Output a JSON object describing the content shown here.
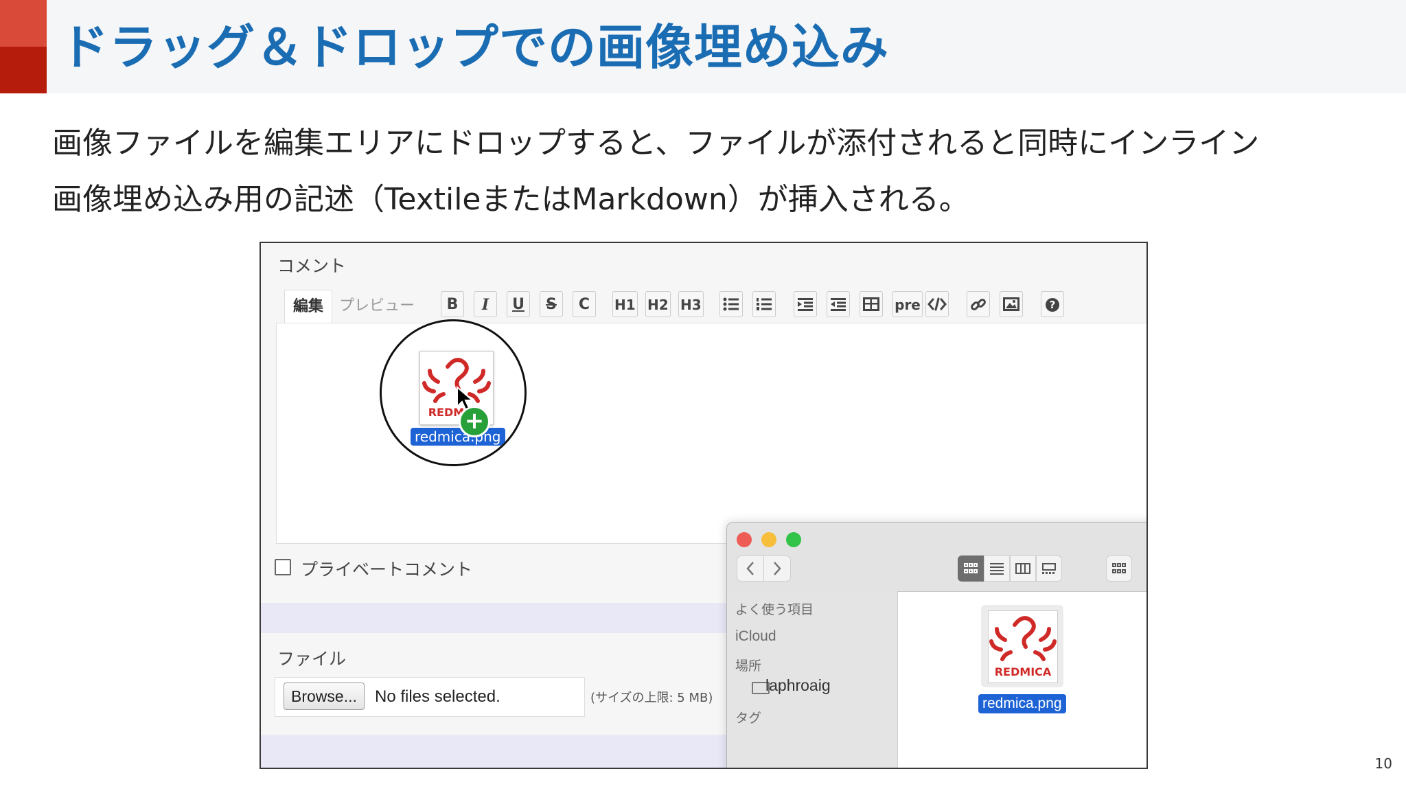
{
  "slide": {
    "title": "ドラッグ＆ドロップでの画像埋め込み",
    "body_line1": "画像ファイルを編集エリアにドロップすると、ファイルが添付されると同時にインライン",
    "body_line2": "画像埋め込み用の記述（TextileまたはMarkdown）が挿入される。",
    "page_number": "10",
    "colors": {
      "title": "#1b6db3",
      "accent_top": "#d94a38",
      "accent_bottom": "#b51c0c"
    }
  },
  "redmine": {
    "comment_label": "コメント",
    "tabs": {
      "edit": "編集",
      "preview": "プレビュー"
    },
    "toolbar": {
      "bold": "B",
      "italic": "I",
      "underline": "U",
      "strike": "S",
      "code": "C",
      "h1": "H1",
      "h2": "H2",
      "h3": "H3",
      "pre": "pre",
      "icons": [
        "unordered-list-icon",
        "ordered-list-icon",
        "indent-icon",
        "outdent-icon",
        "table-icon",
        "code-block-icon",
        "link-icon",
        "image-icon",
        "help-icon"
      ]
    },
    "drag": {
      "filename": "redmica.png",
      "thumb_text": "REDMICA"
    },
    "private_comment_label": "プライベートコメント",
    "file_label": "ファイル",
    "browse_label": "Browse...",
    "no_files": "No files selected.",
    "size_limit": "(サイズの上限: 5 MB)"
  },
  "finder": {
    "sidebar": {
      "favorites": "よく使う項目",
      "icloud": "iCloud",
      "locations": "場所",
      "location_item": "laphroaig",
      "tags": "タグ"
    },
    "file_name": "redmica.png",
    "thumb_text": "REDMICA",
    "selection_color": "#1e63d5"
  }
}
